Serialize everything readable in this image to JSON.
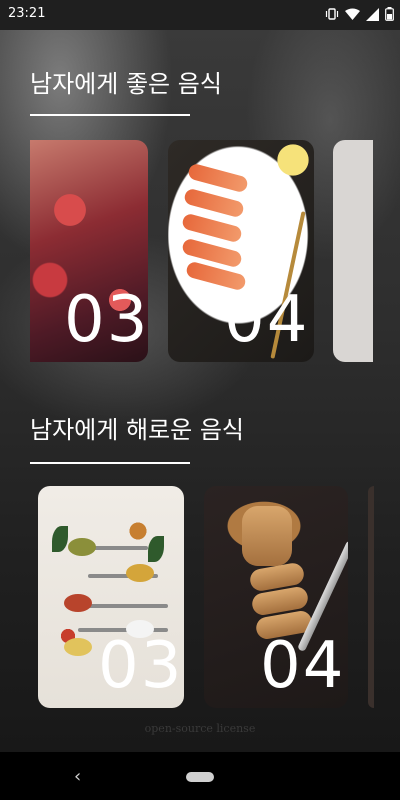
{
  "status_bar": {
    "time": "23:21",
    "icons": [
      "vibrate-icon",
      "wifi-icon",
      "signal-icon",
      "battery-icon"
    ]
  },
  "sections": [
    {
      "title": "남자에게 좋은 음식",
      "cards": [
        {
          "number": "03",
          "image": "octopus"
        },
        {
          "number": "04",
          "image": "shrimp"
        },
        {
          "number": "",
          "image": "blank"
        }
      ]
    },
    {
      "title": "남자에게 해로운 음식",
      "cards": [
        {
          "number": "03",
          "image": "spices"
        },
        {
          "number": "04",
          "image": "bread"
        }
      ]
    }
  ],
  "footer": {
    "license_link": "open-source license"
  },
  "nav_bar": {
    "icons": [
      "back-icon",
      "home-pill-icon"
    ],
    "back_glyph": "‹"
  }
}
